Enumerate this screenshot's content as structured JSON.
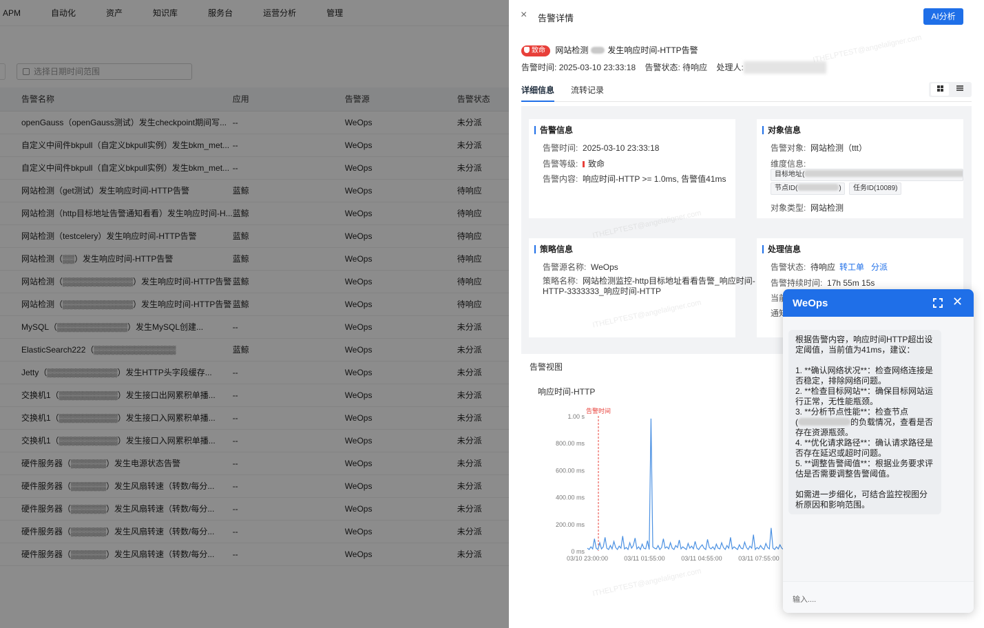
{
  "bg": {
    "nav": [
      "APM",
      "自动化",
      "资产",
      "知识库",
      "服务台",
      "运营分析",
      "管理"
    ],
    "date_placeholder": "选择日期时间范围",
    "columns": [
      "告警名称",
      "应用",
      "告警源",
      "告警状态"
    ],
    "rows": [
      {
        "name": "openGauss（openGauss测试）发生checkpoint期间写...",
        "app": "--",
        "src": "WeOps",
        "status": "未分派"
      },
      {
        "name": "自定义中间件bkpull（自定义bkpull实例）发生bkm_met...",
        "app": "--",
        "src": "WeOps",
        "status": "未分派"
      },
      {
        "name": "自定义中间件bkpull（自定义bkpull实例）发生bkm_met...",
        "app": "--",
        "src": "WeOps",
        "status": "未分派"
      },
      {
        "name": "网站检测（get测试）发生响应时间-HTTP告警",
        "app": "蓝鲸",
        "src": "WeOps",
        "status": "待响应"
      },
      {
        "name": "网站检测（http目标地址告警通知看看）发生响应时间-H...",
        "app": "蓝鲸",
        "src": "WeOps",
        "status": "待响应"
      },
      {
        "name": "网站检测（testcelery）发生响应时间-HTTP告警",
        "app": "蓝鲸",
        "src": "WeOps",
        "status": "待响应"
      },
      {
        "name": "网站检测（▒▒）发生响应时间-HTTP告警",
        "app": "蓝鲸",
        "src": "WeOps",
        "status": "待响应"
      },
      {
        "name": "网站检测（▒▒▒▒▒▒▒▒▒▒▒▒）发生响应时间-HTTP告警",
        "app": "蓝鲸",
        "src": "WeOps",
        "status": "待响应"
      },
      {
        "name": "网站检测（▒▒▒▒▒▒▒▒▒▒▒▒）发生响应时间-HTTP告警",
        "app": "蓝鲸",
        "src": "WeOps",
        "status": "待响应"
      },
      {
        "name": "MySQL（▒▒▒▒▒▒▒▒▒▒▒▒）发生MySQL创建...",
        "app": "--",
        "src": "WeOps",
        "status": "未分派"
      },
      {
        "name": "ElasticSearch222（▒▒▒▒▒▒▒▒▒▒▒▒▒▒",
        "app": "蓝鲸",
        "src": "WeOps",
        "status": "未分派"
      },
      {
        "name": "Jetty（▒▒▒▒▒▒▒▒▒▒▒▒）发生HTTP头字段缓存...",
        "app": "--",
        "src": "WeOps",
        "status": "未分派"
      },
      {
        "name": "交换机1（▒▒▒▒▒▒▒▒▒▒）发生接口出网累积单播...",
        "app": "--",
        "src": "WeOps",
        "status": "未分派"
      },
      {
        "name": "交换机1（▒▒▒▒▒▒▒▒▒▒）发生接口入网累积单播...",
        "app": "--",
        "src": "WeOps",
        "status": "未分派"
      },
      {
        "name": "交换机1（▒▒▒▒▒▒▒▒▒▒）发生接口入网累积单播...",
        "app": "--",
        "src": "WeOps",
        "status": "未分派"
      },
      {
        "name": "硬件服务器（▒▒▒▒▒▒）发生电源状态告警",
        "app": "--",
        "src": "WeOps",
        "status": "未分派"
      },
      {
        "name": "硬件服务器（▒▒▒▒▒▒）发生风扇转速（转数/每分...",
        "app": "--",
        "src": "WeOps",
        "status": "未分派"
      },
      {
        "name": "硬件服务器（▒▒▒▒▒▒）发生风扇转速（转数/每分...",
        "app": "--",
        "src": "WeOps",
        "status": "未分派"
      },
      {
        "name": "硬件服务器（▒▒▒▒▒▒）发生风扇转速（转数/每分...",
        "app": "--",
        "src": "WeOps",
        "status": "未分派"
      },
      {
        "name": "硬件服务器（▒▒▒▒▒▒）发生风扇转速（转数/每分...",
        "app": "--",
        "src": "WeOps",
        "status": "未分派"
      }
    ]
  },
  "drawer": {
    "close": "×",
    "title": "告警详情",
    "ai_button": "AI分析",
    "severity": "致命",
    "alert_name_pre": "网站检测",
    "alert_name_post": "发生响应时间-HTTP告警",
    "time_label": "告警时间:",
    "time_value": "2025-03-10 23:33:18",
    "status_label": "告警状态:",
    "status_value": "待响应",
    "handler_label": "处理人:",
    "tabs": [
      "详细信息",
      "流转记录"
    ],
    "alert_info": {
      "title": "告警信息",
      "time_k": "告警时间:",
      "time_v": "2025-03-10 23:33:18",
      "level_k": "告警等级:",
      "level_v": "致命",
      "content_k": "告警内容:",
      "content_v": "响应时间-HTTP >= 1.0ms, 告警值41ms"
    },
    "object_info": {
      "title": "对象信息",
      "obj_k": "告警对象:",
      "obj_v": "网站检测（ttt）",
      "dim_k": "维度信息:",
      "tag1": "目标地址(",
      "tag2a": "节点ID(",
      "tag2b": ")",
      "tag3": "任务ID(10089)",
      "type_k": "对象类型:",
      "type_v": "网站检测"
    },
    "strategy_info": {
      "title": "策略信息",
      "src_k": "告警源名称:",
      "src_v": "WeOps",
      "name_k": "策略名称:",
      "name_v1": "网站检测监控-http目标地址看看告警_响应时间-",
      "name_v2": "HTTP-3333333_响应时间-HTTP"
    },
    "handle_info": {
      "title": "处理信息",
      "status_k": "告警状态:",
      "status_v": "待响应",
      "link1": "转工单",
      "link2": "分派",
      "dur_k": "告警持续时间:",
      "dur_v": "17h 55m 15s",
      "cur_k": "当前处",
      "notify_k": "通知状"
    },
    "chart_title": "告警视图"
  },
  "chart_data": {
    "type": "line",
    "title": "响应时间-HTTP",
    "marker_label": "告警时间",
    "ylabel_unit": "ms",
    "ylim": [
      0,
      1000
    ],
    "yticks": [
      "0  ms",
      "200.00  ms",
      "400.00  ms",
      "600.00  ms",
      "800.00  ms",
      "1.00  s"
    ],
    "xticks": [
      "03/10 23:00:00",
      "03/11 01:55:00",
      "03/11 04:55:00",
      "03/11 07:55:00"
    ],
    "series": [
      {
        "values": [
          20,
          10,
          30,
          15,
          90,
          20,
          10,
          60,
          15,
          30,
          100,
          20,
          10,
          40,
          15,
          70,
          25,
          10,
          35,
          20,
          110,
          15,
          25,
          10,
          60,
          20,
          40,
          95,
          15,
          30,
          10,
          50,
          20,
          15,
          75,
          10,
          980,
          30,
          20,
          15,
          40,
          10,
          25,
          90,
          20,
          30,
          15,
          60,
          20,
          10,
          40,
          25,
          80,
          15,
          30,
          20,
          10,
          55,
          20,
          35,
          15,
          70,
          20,
          10,
          30,
          45,
          20,
          10,
          85,
          25,
          15,
          30,
          10,
          50,
          20,
          15,
          60,
          25,
          10,
          40,
          20,
          100,
          15,
          30,
          20,
          10,
          45,
          20,
          15,
          65,
          25,
          10,
          35,
          20,
          120,
          10,
          25,
          15,
          40,
          20,
          10,
          55,
          25,
          15,
          170,
          20,
          10,
          30,
          15,
          45,
          20,
          10,
          60,
          15
        ]
      }
    ]
  },
  "chat": {
    "title": "WeOps",
    "intro": "根据告警内容，响应时间HTTP超出设定阈值，当前值为41ms，建议：",
    "items": [
      "1. **确认网络状况**：检查网络连接是否稳定，排除网络问题。",
      "2. **检查目标网站**：确保目标网站运行正常，无性能瓶颈。",
      "3. **分析节点性能**：检查节点",
      "的负载情况，查看是否存在资源瓶颈。",
      "4. **优化请求路径**：确认请求路径是否存在延迟或超时问题。",
      "5. **调整告警阈值**：根据业务要求评估是否需要调整告警阈值。"
    ],
    "outro": "如需进一步细化，可结合监控视图分析原因和影响范围。",
    "placeholder": "输入...."
  }
}
